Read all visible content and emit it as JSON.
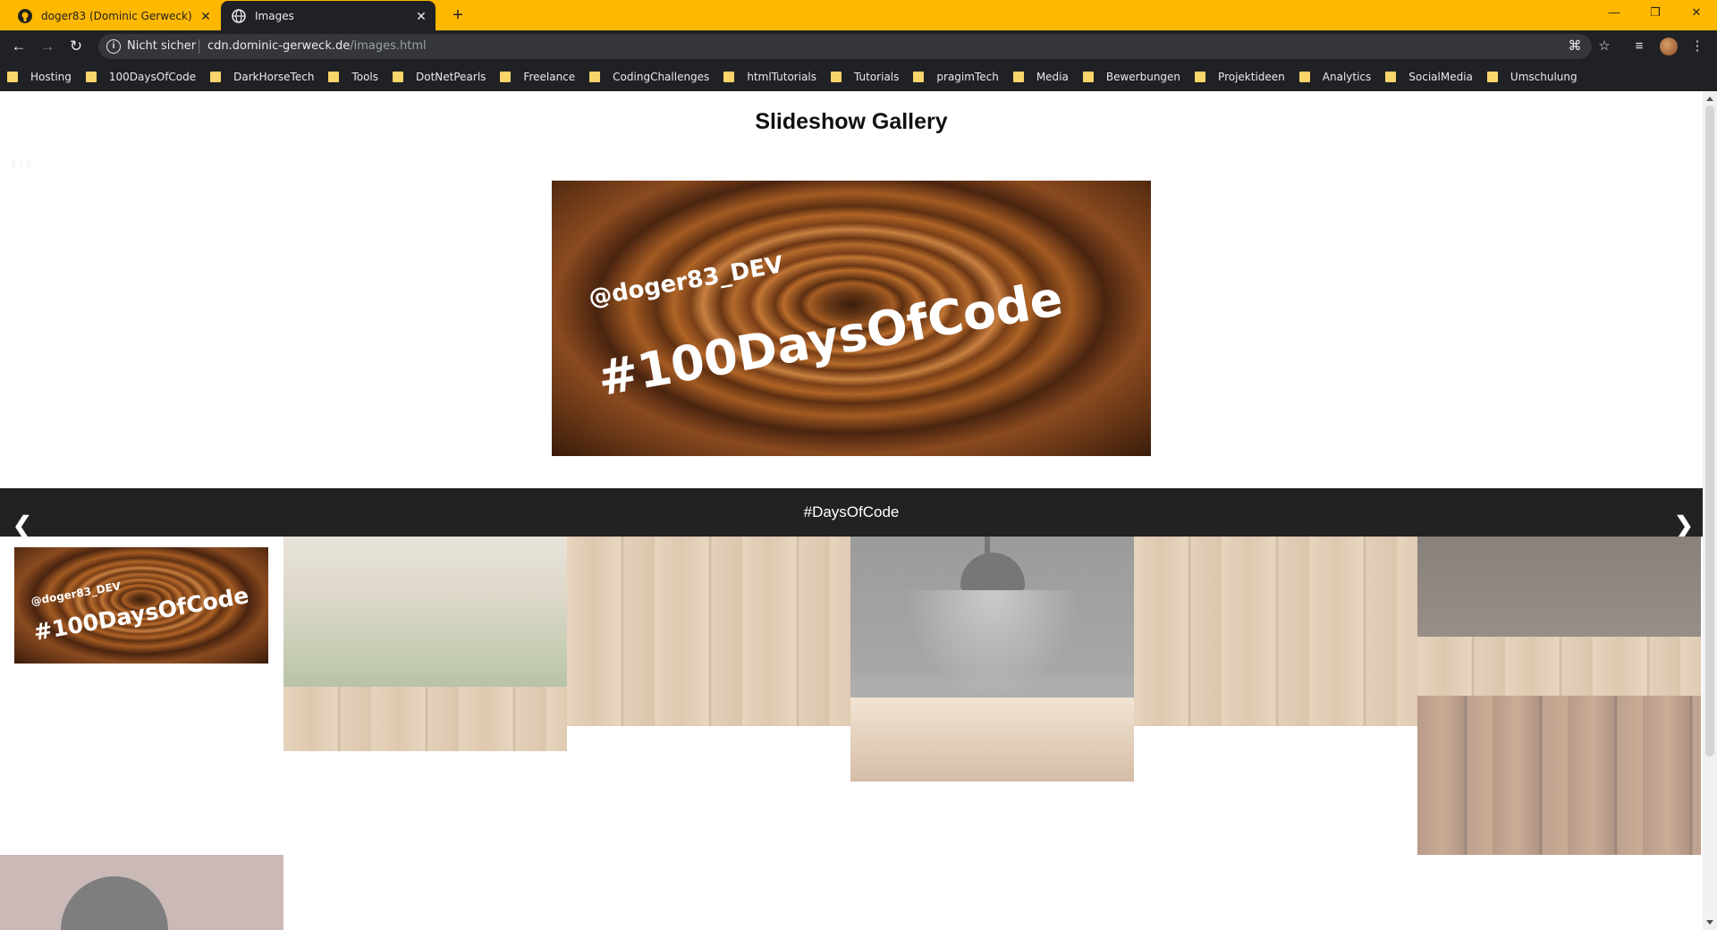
{
  "browser": {
    "tabs": [
      {
        "title": "doger83 (Dominic Gerweck)",
        "active": false
      },
      {
        "title": "Images",
        "active": true
      }
    ],
    "address": {
      "security_label": "Nicht sicher",
      "host": "cdn.dominic-gerweck.de",
      "path": "/images.html"
    },
    "bookmarks": [
      "Hosting",
      "100DaysOfCode",
      "DarkHorseTech",
      "Tools",
      "DotNetPearls",
      "Freelance",
      "CodingChallenges",
      "htmlTutorials",
      "Tutorials",
      "pragimTech",
      "Media",
      "Bewerbungen",
      "Projektideen",
      "Analytics",
      "SocialMedia",
      "Umschulung"
    ],
    "colors": {
      "frame": "#ffb800",
      "toolbar": "#202124"
    }
  },
  "page": {
    "title": "Slideshow Gallery",
    "counter": "1 / 8",
    "caption": "#DaysOfCode",
    "slide_text": {
      "handle": "@doger83_DEV",
      "tag": "#100DaysOfCode"
    },
    "prev_glyph": "❮",
    "next_glyph": "❯"
  }
}
